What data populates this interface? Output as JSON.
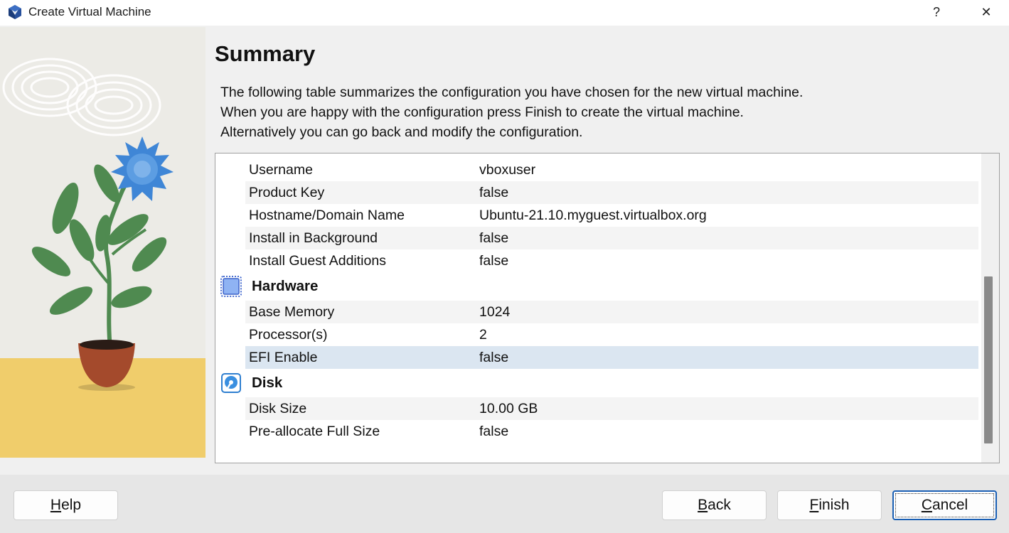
{
  "window": {
    "title": "Create Virtual Machine",
    "help_glyph": "?",
    "close_glyph": "✕"
  },
  "page": {
    "heading": "Summary",
    "description": [
      "The following table summarizes the configuration you have chosen for the new virtual machine.",
      "When you are happy with the configuration press Finish to create the virtual machine.",
      "Alternatively you can go back and modify the configuration."
    ]
  },
  "summary": {
    "unattended_rows": [
      {
        "key": "Username",
        "value": "vboxuser"
      },
      {
        "key": "Product Key",
        "value": "false"
      },
      {
        "key": "Hostname/Domain Name",
        "value": "Ubuntu-21.10.myguest.virtualbox.org"
      },
      {
        "key": "Install in Background",
        "value": "false"
      },
      {
        "key": "Install Guest Additions",
        "value": "false"
      }
    ],
    "hardware": {
      "label": "Hardware",
      "icon": "chip-icon",
      "rows": [
        {
          "key": "Base Memory",
          "value": "1024"
        },
        {
          "key": "Processor(s)",
          "value": "2"
        },
        {
          "key": "EFI Enable",
          "value": "false"
        }
      ]
    },
    "disk": {
      "label": "Disk",
      "icon": "hard-disk-icon",
      "rows": [
        {
          "key": "Disk Size",
          "value": "10.00 GB"
        },
        {
          "key": "Pre-allocate Full Size",
          "value": "false"
        }
      ]
    },
    "selected_row": "EFI Enable"
  },
  "buttons": {
    "help": {
      "label": "Help",
      "mnemonic": "H",
      "rest": "elp"
    },
    "back": {
      "label": "Back",
      "mnemonic": "B",
      "rest": "ack"
    },
    "finish": {
      "label": "Finish",
      "mnemonic": "F",
      "rest": "inish"
    },
    "cancel": {
      "label": "Cancel",
      "mnemonic": "C",
      "rest": "ancel"
    }
  },
  "colors": {
    "accent": "#1a5fb4",
    "selection": "#dbe6f1",
    "banner_ground": "#f0cd6b",
    "flower": "#3f86d6",
    "leaf": "#4f8a50",
    "pot": "#a44a2c"
  }
}
